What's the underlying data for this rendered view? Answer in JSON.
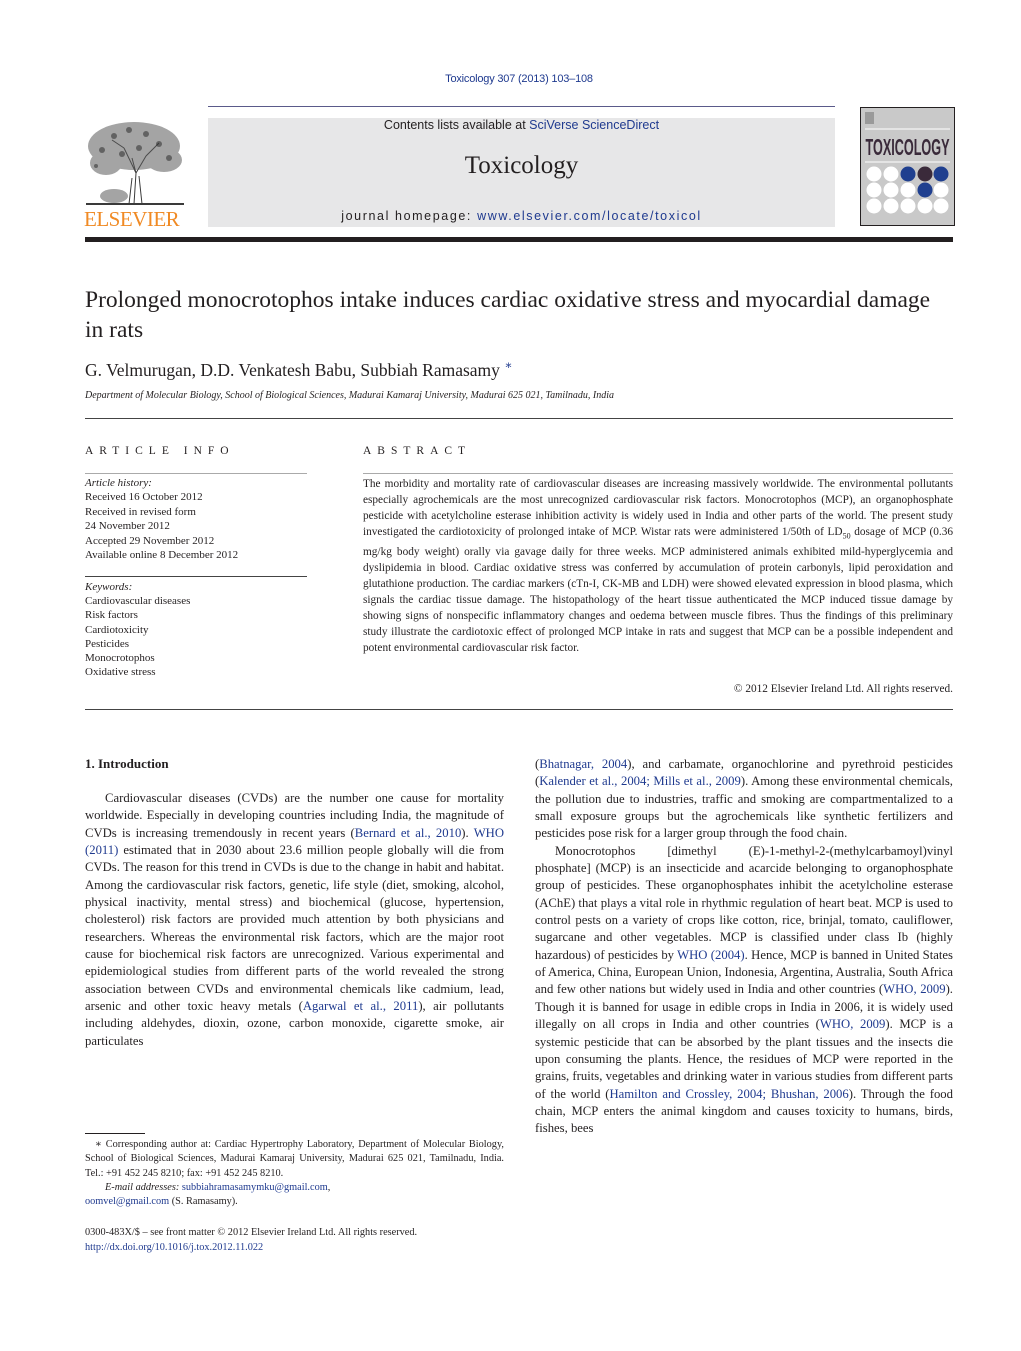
{
  "header": {
    "journal_ref": "Toxicology 307 (2013) 103–108",
    "contents_prefix": "Contents lists available at ",
    "contents_link": "SciVerse ScienceDirect",
    "journal_title": "Toxicology",
    "homepage_prefix": "journal homepage: ",
    "homepage_link": "www.elsevier.com/locate/toxicol",
    "publisher_logo_text": "ELSEVIER",
    "cover_title": "TOXICOLOGY",
    "colors": {
      "link": "#1f3a8f",
      "publisher": "#f08a24",
      "box_bg": "#e7e7e8"
    }
  },
  "article": {
    "title": "Prolonged monocrotophos intake induces cardiac oxidative stress and myocardial damage in rats",
    "authors": "G. Velmurugan, D.D. Venkatesh Babu, Subbiah Ramasamy",
    "author_mark": "∗",
    "affiliation": "Department of Molecular Biology, School of Biological Sciences, Madurai Kamaraj University, Madurai 625 021, Tamilnadu, India"
  },
  "article_info": {
    "heading": "ARTICLE INFO",
    "history_label": "Article history:",
    "history": [
      "Received 16 October 2012",
      "Received in revised form",
      "24 November 2012",
      "Accepted 29 November 2012",
      "Available online 8 December 2012"
    ],
    "keywords_label": "Keywords:",
    "keywords": [
      "Cardiovascular diseases",
      "Risk factors",
      "Cardiotoxicity",
      "Pesticides",
      "Monocrotophos",
      "Oxidative stress"
    ]
  },
  "abstract": {
    "heading": "ABSTRACT",
    "part1": "The morbidity and mortality rate of cardiovascular diseases are increasing massively worldwide. The environmental pollutants especially agrochemicals are the most unrecognized cardiovascular risk factors. Monocrotophos (MCP), an organophosphate pesticide with acetylcholine esterase inhibition activity is widely used in India and other parts of the world. The present study investigated the cardiotoxicity of prolonged intake of MCP. Wistar rats were administered 1/50th of LD",
    "subscript": "50",
    "part2": " dosage of MCP (0.36 mg/kg body weight) orally via gavage daily for three weeks. MCP administered animals exhibited mild-hyperglycemia and dyslipidemia in blood. Cardiac oxidative stress was conferred by accumulation of protein carbonyls, lipid peroxidation and glutathione production. The cardiac markers (cTn-I, CK-MB and LDH) were showed elevated expression in blood plasma, which signals the cardiac tissue damage. The histopathology of the heart tissue authenticated the MCP induced tissue damage by showing signs of nonspecific inflammatory changes and oedema between muscle fibres. Thus the findings of this preliminary study illustrate the cardiotoxic effect of prolonged MCP intake in rats and suggest that MCP can be a possible independent and potent environmental cardiovascular risk factor.",
    "copyright": "© 2012 Elsevier Ireland Ltd. All rights reserved."
  },
  "body": {
    "section_heading": "1.  Introduction",
    "left_p1": [
      {
        "t": "Cardiovascular diseases (CVDs) are the number one cause for mortality worldwide. Especially in developing countries including India, the magnitude of CVDs is increasing tremendously in recent years ("
      },
      {
        "l": "Bernard et al., 2010"
      },
      {
        "t": "). "
      },
      {
        "l": "WHO (2011)"
      },
      {
        "t": " estimated that in 2030 about 23.6 million people globally will die from CVDs. The reason for this trend in CVDs is due to the change in habit and habitat. Among the cardiovascular risk factors, genetic, life style (diet, smoking, alcohol, physical inactivity, mental stress) and biochemical (glucose, hypertension, cholesterol) risk factors are provided much attention by both physicians and researchers. Whereas the environmental risk factors, which are the major root cause for biochemical risk factors are unrecognized. Various experimental and epidemiological studies from different parts of the world revealed the strong association between CVDs and environmental chemicals like cadmium, lead, arsenic and other toxic heavy metals ("
      },
      {
        "l": "Agarwal et al., 2011"
      },
      {
        "t": "), air pollutants including aldehydes, dioxin, ozone, carbon monoxide, cigarette smoke, air particulates"
      }
    ],
    "right_p1": [
      {
        "t": "("
      },
      {
        "l": "Bhatnagar, 2004"
      },
      {
        "t": "), and carbamate, organochlorine and pyrethroid pesticides ("
      },
      {
        "l": "Kalender et al., 2004; Mills et al., 2009"
      },
      {
        "t": "). Among these environmental chemicals, the pollution due to industries, traffic and smoking are compartmentalized to a small exposure groups but the agrochemicals like synthetic fertilizers and pesticides pose risk for a larger group through the food chain."
      }
    ],
    "right_p2": [
      {
        "t": "Monocrotophos [dimethyl (E)-1-methyl-2-(methylcarbamoyl)vinyl phosphate] (MCP) is an insecticide and acarcide belonging to organophosphate group of pesticides. These organophosphates inhibit the acetylcholine esterase (AChE) that plays a vital role in rhythmic regulation of heart beat. MCP is used to control pests on a variety of crops like cotton, rice, brinjal, tomato, cauliflower, sugarcane and other vegetables. MCP is classified under class Ib (highly hazardous) of pesticides by "
      },
      {
        "l": "WHO (2004)"
      },
      {
        "t": ". Hence, MCP is banned in United States of America, China, European Union, Indonesia, Argentina, Australia, South Africa and few other nations but widely used in India and other countries ("
      },
      {
        "l": "WHO, 2009"
      },
      {
        "t": "). Though it is banned for usage in edible crops in India in 2006, it is widely used illegally on all crops in India and other countries ("
      },
      {
        "l": "WHO, 2009"
      },
      {
        "t": "). MCP is a systemic pesticide that can be absorbed by the plant tissues and the insects die upon consuming the plants. Hence, the residues of MCP were reported in the grains, fruits, vegetables and drinking water in various studies from different parts of the world ("
      },
      {
        "l": "Hamilton and Crossley, 2004; Bhushan, 2006"
      },
      {
        "t": "). Through the food chain, MCP enters the animal kingdom and causes toxicity to humans, birds, fishes, bees"
      }
    ]
  },
  "footnote": {
    "corresponding": "∗ Corresponding author at: Cardiac Hypertrophy Laboratory, Department of Molecular Biology, School of Biological Sciences, Madurai Kamaraj University, Madurai 625 021, Tamilnadu, India. Tel.: +91 452 245 8210; fax: +91 452 245 8210.",
    "email_label": "E-mail addresses:",
    "email1": "subbiahramasamymku@gmail.com",
    "email2": "oomvel@gmail.com",
    "email2_suffix": " (S. Ramasamy).",
    "front_matter": "0300-483X/$ – see front matter © 2012 Elsevier Ireland Ltd. All rights reserved.",
    "doi": "http://dx.doi.org/10.1016/j.tox.2012.11.022"
  }
}
